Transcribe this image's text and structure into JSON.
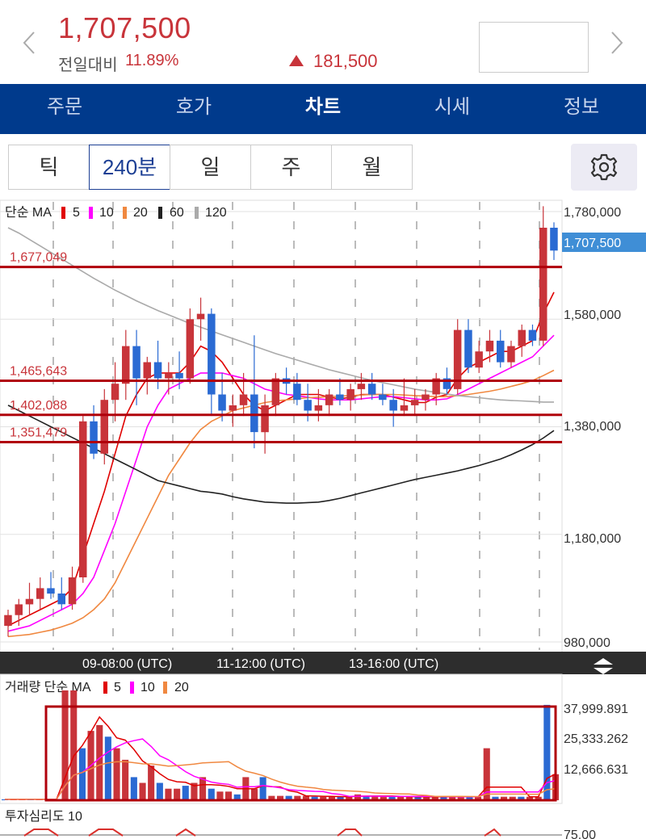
{
  "header": {
    "price": "1,707,500",
    "diff_label": "전일대비",
    "diff_pct": "11.89%",
    "change": "181,500"
  },
  "tabs": [
    {
      "label": "주문"
    },
    {
      "label": "호가"
    },
    {
      "label": "차트"
    },
    {
      "label": "시세"
    },
    {
      "label": "정보"
    }
  ],
  "active_tab": 2,
  "periods": [
    {
      "label": "틱"
    },
    {
      "label": "240분"
    },
    {
      "label": "일"
    },
    {
      "label": "주"
    },
    {
      "label": "월"
    }
  ],
  "selected_period": 1,
  "colors": {
    "up": "#c8343a",
    "down": "#2a6ad3",
    "nav": "#003a8c"
  },
  "chart_data": [
    {
      "type": "candlestick",
      "legend": {
        "title": "단순 MA",
        "items": [
          {
            "label": "5",
            "color": "#e00000"
          },
          {
            "label": "10",
            "color": "#ff00ff"
          },
          {
            "label": "20",
            "color": "#f08840"
          },
          {
            "label": "60",
            "color": "#222222"
          },
          {
            "label": "120",
            "color": "#aaaaaa"
          }
        ]
      },
      "y_ticks": [
        "1,780,000",
        "1,580,000",
        "1,380,000",
        "1,180,000",
        "980,000"
      ],
      "current_price": "1,707,500",
      "levels": [
        {
          "label": "1,677,049",
          "value": 1677049
        },
        {
          "label": "1,465,643",
          "value": 1465643
        },
        {
          "label": "1,402,088",
          "value": 1402088
        },
        {
          "label": "1,351,479",
          "value": 1351479
        }
      ],
      "x_labels": [
        "09-08:00 (UTC)",
        "11-12:00 (UTC)",
        "13-16:00 (UTC)"
      ],
      "candles": [
        [
          1010000,
          1040000,
          990000,
          1030000
        ],
        [
          1030000,
          1060000,
          1010000,
          1050000
        ],
        [
          1050000,
          1090000,
          1030000,
          1060000
        ],
        [
          1060000,
          1100000,
          1040000,
          1080000
        ],
        [
          1080000,
          1110000,
          1060000,
          1070000
        ],
        [
          1070000,
          1100000,
          1040000,
          1050000
        ],
        [
          1050000,
          1120000,
          1040000,
          1100000
        ],
        [
          1100000,
          1400000,
          1090000,
          1390000
        ],
        [
          1390000,
          1420000,
          1320000,
          1330000
        ],
        [
          1330000,
          1450000,
          1310000,
          1430000
        ],
        [
          1430000,
          1500000,
          1390000,
          1460000
        ],
        [
          1460000,
          1560000,
          1430000,
          1530000
        ],
        [
          1530000,
          1560000,
          1420000,
          1470000
        ],
        [
          1470000,
          1510000,
          1440000,
          1500000
        ],
        [
          1500000,
          1540000,
          1450000,
          1470000
        ],
        [
          1470000,
          1500000,
          1440000,
          1480000
        ],
        [
          1480000,
          1520000,
          1450000,
          1470000
        ],
        [
          1470000,
          1600000,
          1460000,
          1580000
        ],
        [
          1580000,
          1620000,
          1540000,
          1590000
        ],
        [
          1590000,
          1600000,
          1400000,
          1440000
        ],
        [
          1440000,
          1480000,
          1390000,
          1410000
        ],
        [
          1410000,
          1440000,
          1380000,
          1420000
        ],
        [
          1420000,
          1480000,
          1400000,
          1440000
        ],
        [
          1440000,
          1550000,
          1340000,
          1370000
        ],
        [
          1370000,
          1440000,
          1330000,
          1420000
        ],
        [
          1420000,
          1480000,
          1400000,
          1470000
        ],
        [
          1470000,
          1490000,
          1440000,
          1460000
        ],
        [
          1460000,
          1480000,
          1420000,
          1430000
        ],
        [
          1430000,
          1460000,
          1390000,
          1410000
        ],
        [
          1410000,
          1450000,
          1390000,
          1420000
        ],
        [
          1420000,
          1450000,
          1400000,
          1440000
        ],
        [
          1440000,
          1470000,
          1420000,
          1430000
        ],
        [
          1430000,
          1460000,
          1410000,
          1450000
        ],
        [
          1450000,
          1480000,
          1430000,
          1460000
        ],
        [
          1460000,
          1480000,
          1430000,
          1440000
        ],
        [
          1440000,
          1460000,
          1420000,
          1430000
        ],
        [
          1430000,
          1450000,
          1380000,
          1410000
        ],
        [
          1410000,
          1470000,
          1400000,
          1420000
        ],
        [
          1420000,
          1450000,
          1400000,
          1430000
        ],
        [
          1430000,
          1450000,
          1410000,
          1440000
        ],
        [
          1440000,
          1480000,
          1420000,
          1470000
        ],
        [
          1470000,
          1490000,
          1440000,
          1450000
        ],
        [
          1450000,
          1580000,
          1440000,
          1560000
        ],
        [
          1560000,
          1580000,
          1480000,
          1490000
        ],
        [
          1490000,
          1540000,
          1480000,
          1520000
        ],
        [
          1520000,
          1560000,
          1500000,
          1540000
        ],
        [
          1540000,
          1560000,
          1490000,
          1500000
        ],
        [
          1500000,
          1540000,
          1490000,
          1530000
        ],
        [
          1530000,
          1570000,
          1510000,
          1560000
        ],
        [
          1560000,
          1570000,
          1530000,
          1540000
        ],
        [
          1540000,
          1790000,
          1530000,
          1750000
        ],
        [
          1750000,
          1760000,
          1690000,
          1707500
        ]
      ],
      "ma": {
        "5": [
          1010000,
          1020000,
          1030000,
          1040000,
          1050000,
          1060000,
          1080000,
          1140000,
          1200000,
          1260000,
          1330000,
          1400000,
          1440000,
          1470000,
          1480000,
          1480000,
          1480000,
          1500000,
          1530000,
          1520000,
          1500000,
          1470000,
          1440000,
          1420000,
          1410000,
          1420000,
          1430000,
          1440000,
          1440000,
          1440000,
          1435000,
          1432000,
          1435000,
          1440000,
          1440000,
          1440000,
          1435000,
          1430000,
          1425000,
          1425000,
          1435000,
          1440000,
          1470000,
          1490000,
          1500000,
          1510000,
          1520000,
          1520000,
          1530000,
          1540000,
          1590000,
          1630000
        ],
        "10": [
          1000000,
          1005000,
          1010000,
          1020000,
          1030000,
          1040000,
          1050000,
          1070000,
          1100000,
          1150000,
          1200000,
          1260000,
          1320000,
          1380000,
          1420000,
          1450000,
          1460000,
          1470000,
          1480000,
          1480000,
          1480000,
          1475000,
          1470000,
          1460000,
          1450000,
          1445000,
          1440000,
          1438000,
          1435000,
          1432000,
          1430000,
          1430000,
          1430000,
          1432000,
          1434000,
          1436000,
          1436000,
          1434000,
          1432000,
          1430000,
          1430000,
          1432000,
          1440000,
          1450000,
          1460000,
          1470000,
          1480000,
          1490000,
          1500000,
          1510000,
          1530000,
          1550000
        ],
        "20": [
          990000,
          992000,
          994000,
          998000,
          1002000,
          1008000,
          1015000,
          1025000,
          1040000,
          1060000,
          1090000,
          1130000,
          1170000,
          1210000,
          1250000,
          1290000,
          1320000,
          1350000,
          1375000,
          1390000,
          1400000,
          1410000,
          1415000,
          1420000,
          1425000,
          1428000,
          1430000,
          1432000,
          1434000,
          1435000,
          1436000,
          1437000,
          1438000,
          1439000,
          1440000,
          1440000,
          1440000,
          1439000,
          1438000,
          1437000,
          1436000,
          1436000,
          1438000,
          1440000,
          1443000,
          1446000,
          1450000,
          1455000,
          1460000,
          1466000,
          1475000,
          1485000
        ],
        "60": [
          1420000,
          1410000,
          1400000,
          1390000,
          1380000,
          1370000,
          1360000,
          1350000,
          1340000,
          1330000,
          1320000,
          1310000,
          1300000,
          1290000,
          1280000,
          1275000,
          1270000,
          1265000,
          1260000,
          1258000,
          1255000,
          1250000,
          1246000,
          1243000,
          1240000,
          1239000,
          1238000,
          1238000,
          1239000,
          1240000,
          1243000,
          1247000,
          1252000,
          1257000,
          1262000,
          1267000,
          1272000,
          1277000,
          1282000,
          1286000,
          1290000,
          1294000,
          1298000,
          1303000,
          1308000,
          1314000,
          1320000,
          1328000,
          1337000,
          1347000,
          1359000,
          1373000
        ],
        "120": [
          1750000,
          1740000,
          1728000,
          1716000,
          1704000,
          1692000,
          1680000,
          1668000,
          1656000,
          1645000,
          1634000,
          1624000,
          1614000,
          1605000,
          1596000,
          1588000,
          1580000,
          1572000,
          1565000,
          1558000,
          1551000,
          1544000,
          1537000,
          1530000,
          1523000,
          1516000,
          1510000,
          1504000,
          1498000,
          1492000,
          1486000,
          1481000,
          1476000,
          1471000,
          1466000,
          1462000,
          1458000,
          1454000,
          1450000,
          1447000,
          1444000,
          1441000,
          1438000,
          1436000,
          1434000,
          1432000,
          1430000,
          1429000,
          1428000,
          1427000,
          1426000,
          1426000
        ]
      }
    },
    {
      "type": "bar",
      "legend": {
        "title": "거래량 단순 MA",
        "items": [
          {
            "label": "5",
            "color": "#e00000"
          },
          {
            "label": "10",
            "color": "#ff00ff"
          },
          {
            "label": "20",
            "color": "#f08840"
          }
        ]
      },
      "y_ticks": [
        "37,999.891",
        "25,333.262",
        "12,666.631"
      ],
      "ylim": [
        0,
        38000
      ],
      "values": [
        300,
        300,
        300,
        300,
        300,
        300,
        300,
        60000,
        60000,
        18000,
        24000,
        26000,
        22000,
        18000,
        14000,
        8000,
        6000,
        12000,
        6000,
        4000,
        4000,
        5000,
        6000,
        8000,
        4000,
        3000,
        3000,
        2000,
        8000,
        4000,
        8000,
        1500,
        1500,
        1500,
        1500,
        1500,
        1200,
        1200,
        1200,
        1200,
        1200,
        2000,
        1500,
        1500,
        1200,
        1200,
        1200,
        1200,
        1200,
        1200,
        1200,
        1200,
        1200,
        1200,
        1200,
        1200,
        18000,
        1200,
        1200,
        1200,
        1200,
        1200,
        1200,
        33000,
        9000
      ]
    },
    {
      "type": "line",
      "legend": {
        "title": "투자심리도 10"
      },
      "y_ticks": [
        "75.00"
      ]
    }
  ]
}
